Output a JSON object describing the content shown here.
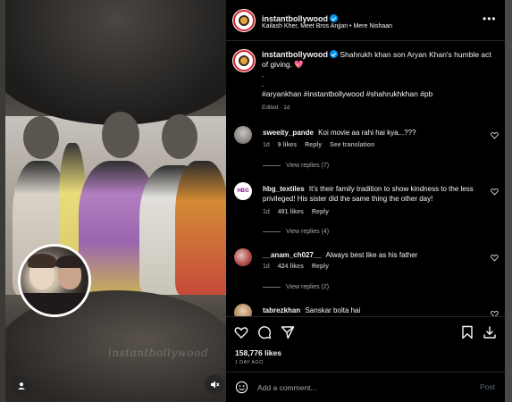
{
  "header": {
    "username": "instantbollywood",
    "audio": "Kailash Kher, Meet Bros Anjjan • Mere Nishaan"
  },
  "media": {
    "watermark": "instantbollywood"
  },
  "caption": {
    "username": "instantbollywood",
    "text": "Shahrukh khan son Aryan Khan's humble act of giving. 💖",
    "dot1": ".",
    "dot2": ".",
    "hashtags": "#aryankhan #instantbollywood #shahrukhkhan #pb",
    "edited": "Edited · 1d"
  },
  "comments": [
    {
      "username": "sweeity_pande",
      "text": "Koi movie aa rahi hai kya...???",
      "time": "1d",
      "likes": "9 likes",
      "reply": "Reply",
      "translation": "See translation",
      "view_replies": "View replies (7)"
    },
    {
      "username": "hbg_textiles",
      "text": "It's their family tradition to show kindness to the less privileged! His sister did the same thing the other day!",
      "time": "1d",
      "likes": "491 likes",
      "reply": "Reply",
      "view_replies": "View replies (4)",
      "logo_text": "HBG"
    },
    {
      "username": "__anam_ch027__",
      "text": "Always best like as his father",
      "time": "1d",
      "likes": "424 likes",
      "reply": "Reply",
      "view_replies": "View replies (2)"
    },
    {
      "username": "tabrezkhan",
      "text": "Sanskar bolta hai"
    }
  ],
  "stats": {
    "likes": "158,776 likes",
    "time_ago": "1 DAY AGO"
  },
  "composer": {
    "placeholder": "Add a comment...",
    "post_label": "Post"
  },
  "colors": {
    "panel_bg": "#000000",
    "verified": "#0095f6",
    "muted_text": "#a8a8a8",
    "post_disabled": "#5a6a79"
  }
}
